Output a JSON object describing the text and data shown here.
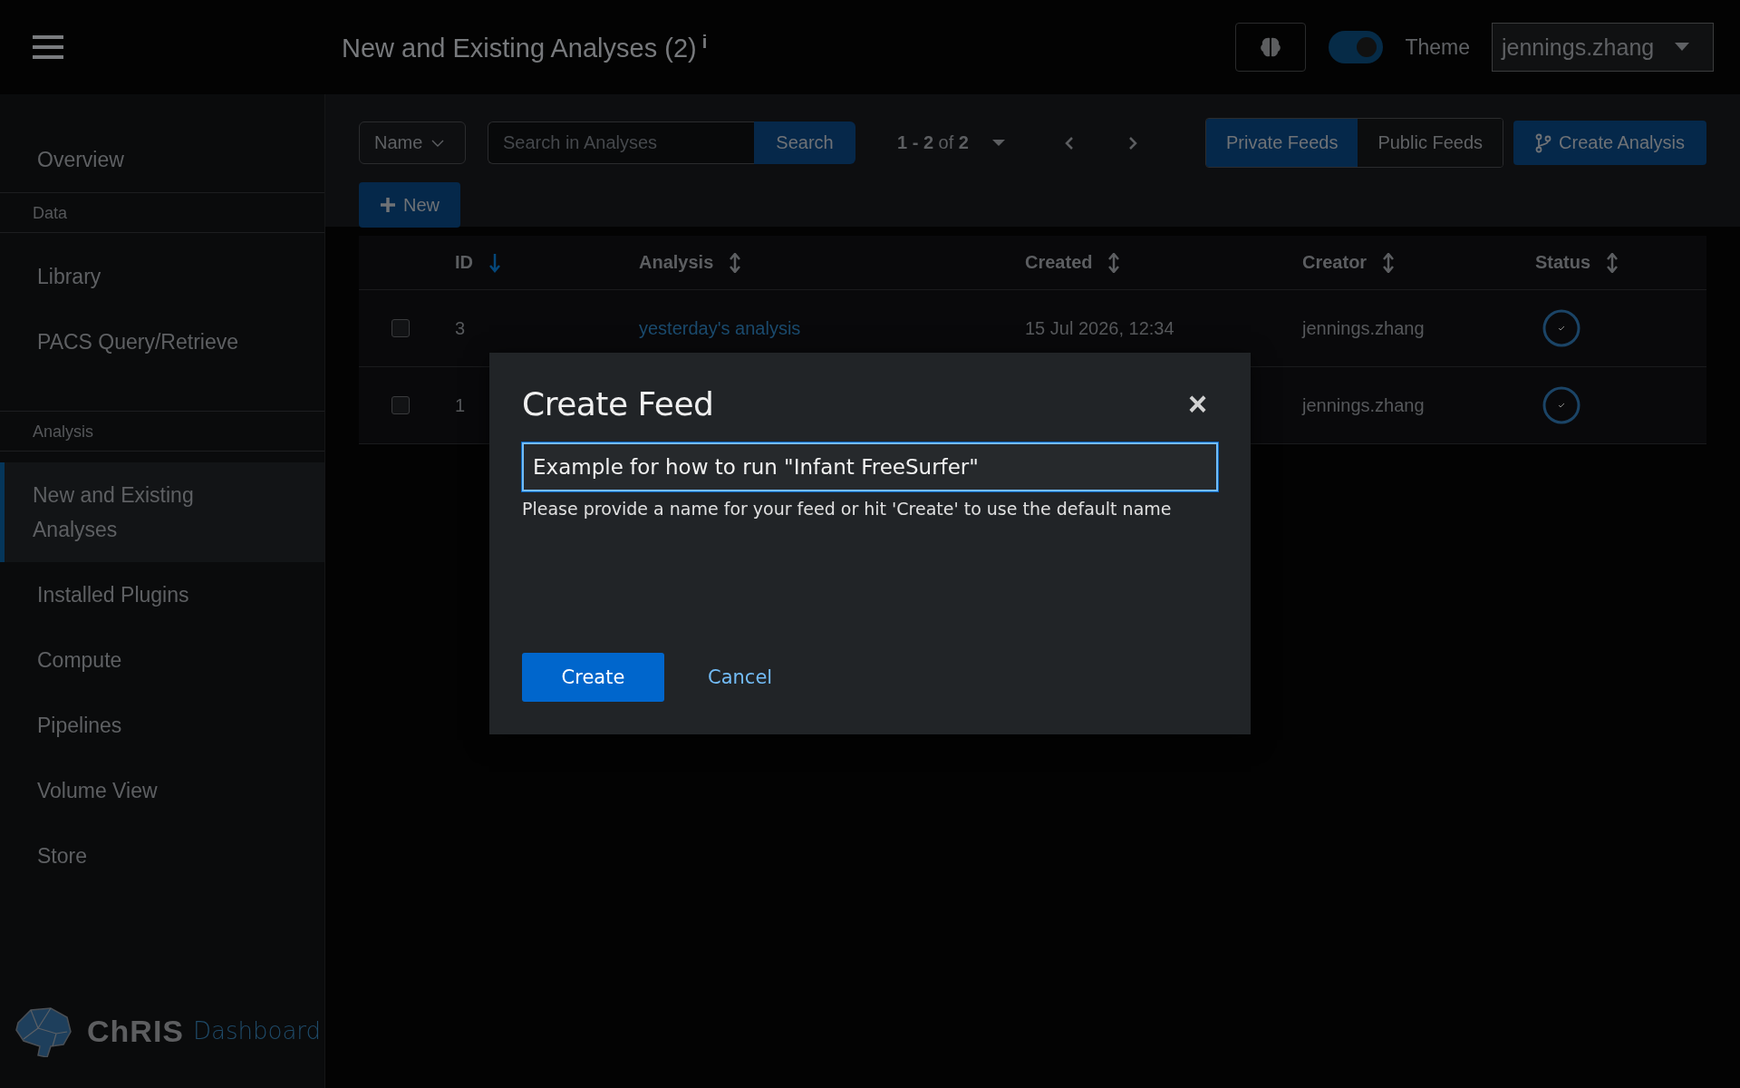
{
  "header": {
    "title": "New and Existing Analyses (2)",
    "info_mark": "i",
    "theme_toggle": {
      "label": "Theme",
      "on": true
    },
    "user": "jennings.zhang"
  },
  "sidebar": {
    "items": [
      {
        "kind": "item",
        "label": "Overview",
        "selected": false
      },
      {
        "kind": "section",
        "label": "Data"
      },
      {
        "kind": "item",
        "label": "Library",
        "selected": false
      },
      {
        "kind": "item",
        "label": "PACS Query/Retrieve",
        "selected": false
      },
      {
        "kind": "section",
        "label": "Analysis"
      },
      {
        "kind": "item",
        "label": "New and Existing Analyses",
        "selected": true
      },
      {
        "kind": "item",
        "label": "Installed Plugins",
        "selected": false
      },
      {
        "kind": "item",
        "label": "Compute",
        "selected": false
      },
      {
        "kind": "item",
        "label": "Pipelines",
        "selected": false
      },
      {
        "kind": "item",
        "label": "Volume View",
        "selected": false
      },
      {
        "kind": "item",
        "label": "Store",
        "selected": false
      }
    ],
    "logo": {
      "brand": "ChRIS",
      "product": "Dashboard"
    }
  },
  "toolbar": {
    "filter": "Name",
    "search": {
      "placeholder": "Search in Analyses",
      "button": "Search"
    },
    "pagination": {
      "range": "1 - 2",
      "of": "of",
      "total": "2"
    },
    "feed_tabs": [
      {
        "label": "Private Feeds",
        "selected": true
      },
      {
        "label": "Public Feeds",
        "selected": false
      }
    ],
    "create_analysis": "Create Analysis",
    "new_button": "New"
  },
  "table": {
    "columns": [
      {
        "label": "ID",
        "sorted": true
      },
      {
        "label": "Analysis",
        "sorted": false
      },
      {
        "label": "Created",
        "sorted": false
      },
      {
        "label": "Creator",
        "sorted": false
      },
      {
        "label": "Status",
        "sorted": false
      }
    ],
    "rows": [
      {
        "checked": false,
        "id": "3",
        "analysis": "yesterday's analysis",
        "created": "15 Jul 2026, 12:34",
        "creator": "jennings.zhang"
      },
      {
        "checked": false,
        "id": "1",
        "creator": "jennings.zhang"
      }
    ]
  },
  "modal": {
    "title": "Create Feed",
    "close": "×",
    "value": "Example for how to run \"Infant FreeSurfer\"",
    "helper": "Please provide a name for your feed or hit 'Create' to use the default name",
    "create": "Create",
    "cancel": "Cancel"
  }
}
